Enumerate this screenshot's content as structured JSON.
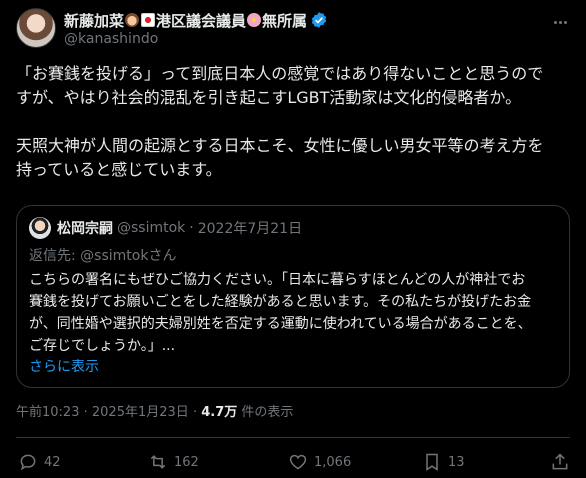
{
  "author": {
    "name": "新藤加菜",
    "name_suffix": "港区議会議員",
    "name_suffix2": "無所属",
    "handle": "@kanashindo"
  },
  "tweet": {
    "paragraph1_line1": "「お賽銭を投げる」って到底日本人の感覚ではあり得ないことと思うので",
    "paragraph1_line2": "すが、やはり社会的混乱を引き起こすLGBT活動家は文化的侵略者か。",
    "paragraph2_line1": "天照大神が人間の起源とする日本こそ、女性に優しい男女平等の考え方を",
    "paragraph2_line2": "持っていると感じています。"
  },
  "quoted": {
    "name": "松岡宗嗣",
    "handle": "@ssimtok",
    "separator": "·",
    "date": "2022年7月21日",
    "reply_prefix": "返信先:",
    "reply_to": "@ssimtokさん",
    "line1": "こちらの署名にもぜひご協力ください。「日本に暮らすほとんどの人が神社でお",
    "line2": "賽銭を投げてお願いごとをした経験があると思います。その私たちが投げたお金",
    "line3": "が、同性婚や選択的夫婦別姓を否定する運動に使われている場合があることを、",
    "line4": "ご存じでしょうか。」...",
    "show_more": "さらに表示"
  },
  "meta": {
    "time": "午前10:23",
    "separator1": "·",
    "date": "2025年1月23日",
    "separator2": "·",
    "views": "4.7万",
    "views_suffix": "件の表示"
  },
  "actions": {
    "replies": "42",
    "reposts": "162",
    "likes": "1,066",
    "bookmarks": "13"
  },
  "colors": {
    "background": "#000000",
    "text": "#e7e9ea",
    "secondary": "#71767b",
    "accent": "#1d9bf0",
    "border": "#2f3336"
  },
  "icons": [
    "verified-badge-icon",
    "more-icon",
    "reply-icon",
    "repost-icon",
    "like-icon",
    "bookmark-icon",
    "share-icon"
  ]
}
